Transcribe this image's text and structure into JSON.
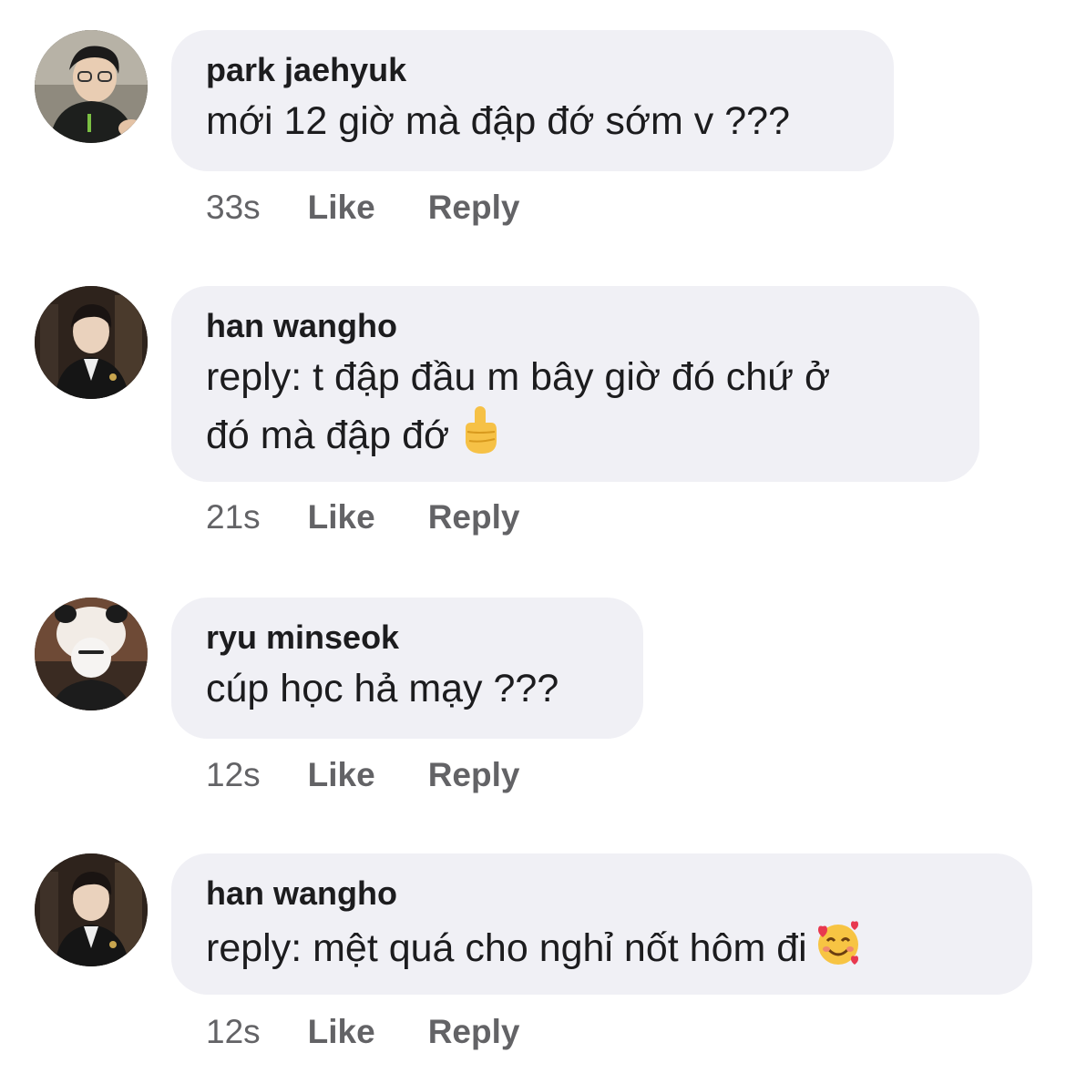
{
  "comments": [
    {
      "author": "park jaehyuk",
      "text": "mới 12 giờ mà đập đớ sớm v ???",
      "time": "33s",
      "like_label": "Like",
      "reply_label": "Reply"
    },
    {
      "author": "han wangho",
      "text_line1": "reply: t đập đầu m bây giờ đó chứ ở",
      "text_line2": "đó mà đập đớ",
      "emoji": "middle-finger-emoji",
      "time": "21s",
      "like_label": "Like",
      "reply_label": "Reply"
    },
    {
      "author": "ryu minseok",
      "text": "cúp học hả mạy ???",
      "time": "12s",
      "like_label": "Like",
      "reply_label": "Reply"
    },
    {
      "author": "han wangho",
      "text": "reply: mệt quá cho nghỉ nốt hôm đi",
      "emoji": "smiling-face-with-hearts-emoji",
      "time": "12s",
      "like_label": "Like",
      "reply_label": "Reply"
    }
  ],
  "colors": {
    "bubble_background": "#f0f0f5",
    "primary_text": "#1c1c1e",
    "secondary_text": "#636366"
  }
}
